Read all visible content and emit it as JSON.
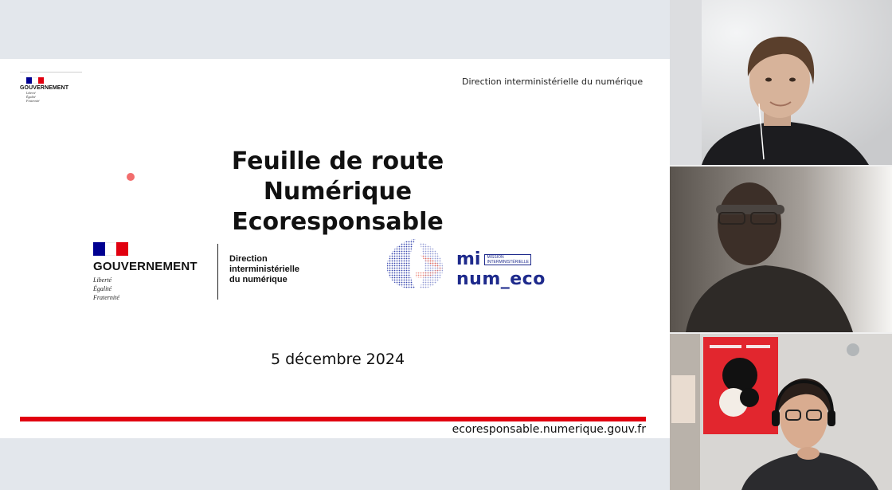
{
  "slide": {
    "header_right": "Direction interministérielle du numérique",
    "gov_small": {
      "name": "GOUVERNEMENT",
      "motto": [
        "Liberté",
        "Égalité",
        "Fraternité"
      ]
    },
    "title_lines": [
      "Feuille de route",
      "Numérique",
      "Ecoresponsable"
    ],
    "gov_big": {
      "name": "GOUVERNEMENT",
      "motto": [
        "Liberté",
        "Égalité",
        "Fraternité"
      ]
    },
    "dinum_lines": [
      "Direction",
      "interministérielle",
      "du numérique"
    ],
    "mne": {
      "mi": "mi",
      "mission_lines": [
        "MISSION",
        "INTERMINISTÉRIELLE"
      ],
      "num": "num_eco"
    },
    "date": "5 décembre 2024",
    "footer_url": "ecoresponsable.numerique.gouv.fr"
  },
  "colors": {
    "flag_blue": "#000091",
    "flag_white": "#ffffff",
    "flag_red": "#e1000f",
    "footer_bar": "#e1000f",
    "brand_navy": "#1e2a8c",
    "accent_dot": "#f26d6d"
  },
  "participants": [
    {
      "tile": "participant-video-1"
    },
    {
      "tile": "participant-video-2"
    },
    {
      "tile": "participant-video-3"
    }
  ]
}
